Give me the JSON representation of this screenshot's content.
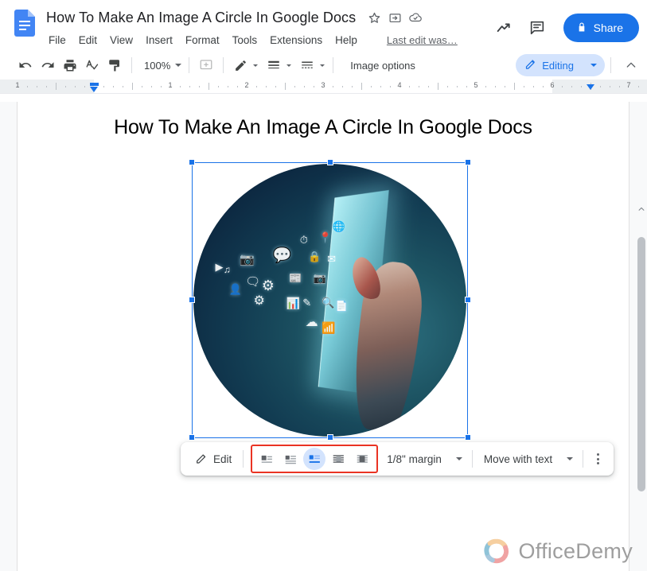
{
  "app": {
    "name": "Google Docs",
    "logo_icon": "google-docs-icon"
  },
  "header": {
    "doc_title": "How To Make An Image A Circle In Google Docs",
    "title_icons": [
      {
        "name": "star-icon",
        "glyph": "☆"
      },
      {
        "name": "move-to-folder-icon",
        "glyph": "folder"
      },
      {
        "name": "document-status-cloud-icon",
        "glyph": "cloud"
      }
    ],
    "menu": [
      {
        "label": "File"
      },
      {
        "label": "Edit"
      },
      {
        "label": "View"
      },
      {
        "label": "Insert"
      },
      {
        "label": "Format"
      },
      {
        "label": "Tools"
      },
      {
        "label": "Extensions"
      },
      {
        "label": "Help"
      }
    ],
    "last_edit": "Last edit was…",
    "right_icons": [
      {
        "name": "activity-dashboard-icon"
      },
      {
        "name": "show-comments-icon"
      }
    ],
    "share": {
      "label": "Share",
      "lock_icon": "lock-icon",
      "color": "#1a73e8"
    }
  },
  "toolbar": {
    "undo_icon": "undo-icon",
    "redo_icon": "redo-icon",
    "print_icon": "print-icon",
    "spelling_icon": "spelling-check-icon",
    "paint_format_icon": "paint-format-icon",
    "zoom_value": "100%",
    "comment_icon": "add-comment-icon",
    "border_color_icon": "border-color-pencil-icon",
    "border_weight_icon": "border-weight-icon",
    "border_dash_icon": "border-dash-icon",
    "image_options_label": "Image options",
    "mode": {
      "label": "Editing",
      "icon": "edit-pencil-icon",
      "color": "#1a73e8",
      "chip_bg": "#d3e3fd"
    },
    "collapse_icon": "collapse-chevron-up-icon"
  },
  "ruler": {
    "numbers": [
      "1",
      "1",
      "2",
      "3",
      "4",
      "5",
      "6",
      "7"
    ],
    "left_indent_marker": "left-indent-marker",
    "right_indent_marker": "right-indent-marker"
  },
  "document": {
    "title": "How To Make An Image A Circle In Google Docs",
    "image": {
      "name": "circular-image",
      "alt": "Hand touching glowing screen with floating technology icons",
      "shape": "circle",
      "selected": true,
      "handles": 8
    }
  },
  "image_toolbar": {
    "edit_label": "Edit",
    "edit_icon": "edit-pencil-icon",
    "wrap_options": [
      {
        "name": "wrap-inline-with-text",
        "active": false
      },
      {
        "name": "wrap-text",
        "active": false
      },
      {
        "name": "wrap-break-text",
        "active": true
      },
      {
        "name": "wrap-behind-text",
        "active": false
      },
      {
        "name": "wrap-in-front-of-text",
        "active": false
      }
    ],
    "margin_label": "1/8\" margin",
    "position_label": "Move with text",
    "more_options_icon": "more-options-kebab-icon",
    "highlight_color": "#ea3323"
  },
  "watermark": {
    "text": "OfficeDemy",
    "logo_icon": "officedemy-ring-logo"
  },
  "scrollbar": {
    "vertical_name": "vertical-scrollbar"
  }
}
